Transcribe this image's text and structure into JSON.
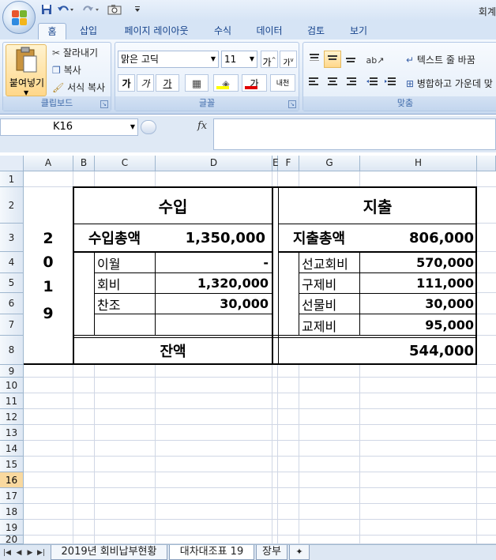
{
  "window": {
    "title": "회계"
  },
  "quick_access": {
    "icons": [
      "save-icon",
      "undo-icon",
      "redo-icon",
      "camera-icon",
      "customize-icon"
    ]
  },
  "ribbon": {
    "tabs": [
      "홈",
      "삽입",
      "페이지 레이아웃",
      "수식",
      "데이터",
      "검토",
      "보기"
    ],
    "active_tab": "홈",
    "clipboard": {
      "paste": "붙여넣기",
      "cut": "잘라내기",
      "copy": "복사",
      "format_painter": "서식 복사",
      "label": "클립보드"
    },
    "font": {
      "name": "맑은 고딕",
      "size": "11",
      "grow": "가",
      "shrink": "가",
      "bold": "가",
      "italic": "가",
      "underline": "가",
      "font_color": "가",
      "phonetic": "내천",
      "label": "글꼴"
    },
    "alignment": {
      "wrap_text": "텍스트 줄 바꿈",
      "merge_center": "병합하고 가운데 맞",
      "label": "맞춤"
    }
  },
  "formula_bar": {
    "name_box": "K16",
    "fx": "fx",
    "value": ""
  },
  "sheet": {
    "columns": [
      "A",
      "B",
      "C",
      "D",
      "E",
      "F",
      "G",
      "H"
    ],
    "rows": [
      "1",
      "2",
      "3",
      "4",
      "5",
      "6",
      "7",
      "8",
      "9",
      "10",
      "11",
      "12",
      "13",
      "14",
      "15",
      "16",
      "17",
      "18",
      "19",
      "20"
    ],
    "selected_row": "16",
    "content": {
      "year_digits": [
        "2",
        "0",
        "1",
        "9"
      ],
      "income_header": "수입",
      "expense_header": "지출",
      "income_total_label": "수입총액",
      "income_total": "1,350,000",
      "expense_total_label": "지출총액",
      "expense_total": "806,000",
      "income_items": [
        {
          "label": "이월",
          "amount": "-"
        },
        {
          "label": "회비",
          "amount": "1,320,000"
        },
        {
          "label": "찬조",
          "amount": "30,000"
        },
        {
          "label": "",
          "amount": ""
        }
      ],
      "expense_items": [
        {
          "label": "선교회비",
          "amount": "570,000"
        },
        {
          "label": "구제비",
          "amount": "111,000"
        },
        {
          "label": "선물비",
          "amount": "30,000"
        },
        {
          "label": "교제비",
          "amount": "95,000"
        }
      ],
      "balance_label": "잔액",
      "balance": "544,000"
    }
  },
  "sheet_tabs": [
    "2019년 회비납부현황",
    "대차대조표 19",
    "장부"
  ],
  "active_sheet_tab": "대차대조표 19"
}
